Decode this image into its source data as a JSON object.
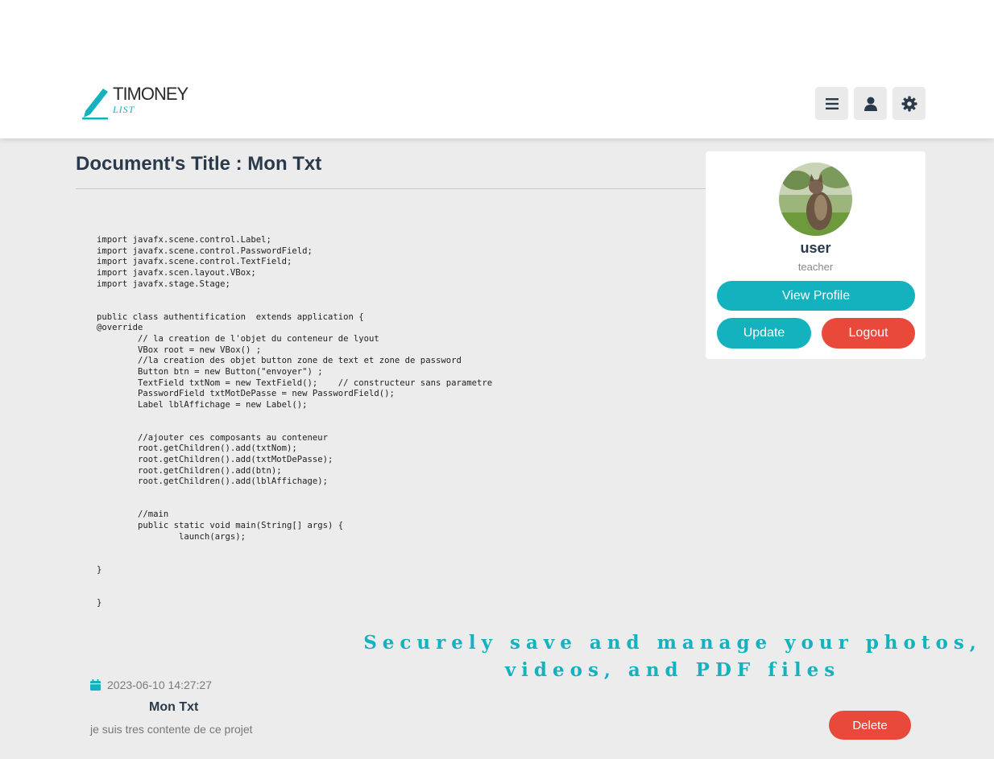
{
  "brand": {
    "name": "TIMONEY",
    "sub": "LIST",
    "accent": "#14b1bf"
  },
  "nav": {
    "buttons": [
      {
        "name": "menu",
        "icon": "bars-icon"
      },
      {
        "name": "account",
        "icon": "user-icon"
      },
      {
        "name": "settings",
        "icon": "gear-icon"
      }
    ]
  },
  "document": {
    "title": "Document's Title : Mon Txt",
    "content": "import javafx.scene.control.Label;\nimport javafx.scene.control.PasswordField;\nimport javafx.scene.control.TextField;\nimport javafx.scen.layout.VBox;\nimport javafx.stage.Stage;\n\n\npublic class authentification  extends application {\n@override\n        // la creation de l'objet du conteneur de lyout\n        VBox root = new VBox() ;\n        //la creation des objet button zone de text et zone de password\n        Button btn = new Button(\"envoyer\") ;\n        TextField txtNom = new TextField();    // constructeur sans parametre\n        PasswordField txtMotDePasse = new PasswordField();\n        Label lblAffichage = new Label();\n\n\n        //ajouter ces composants au conteneur\n        root.getChildren().add(txtNom);\n        root.getChildren().add(txtMotDePasse);\n        root.getChildren().add(btn);\n        root.getChildren().add(lblAffichage);\n\n\n        //main\n        public static void main(String[] args) {\n                launch(args);\n\n\n}\n\n\n}"
  },
  "profile": {
    "name": "user",
    "role": "teacher",
    "view_profile_label": "View Profile",
    "update_label": "Update",
    "logout_label": "Logout"
  },
  "tagline": "Securely save and manage your photos, videos, and PDF files",
  "item": {
    "date": "2023-06-10 14:27:27",
    "title": "Mon Txt",
    "description": "je suis tres contente de ce projet",
    "delete_label": "Delete"
  },
  "colors": {
    "teal": "#14b1bf",
    "red": "#e8493a",
    "background": "#ececec"
  }
}
